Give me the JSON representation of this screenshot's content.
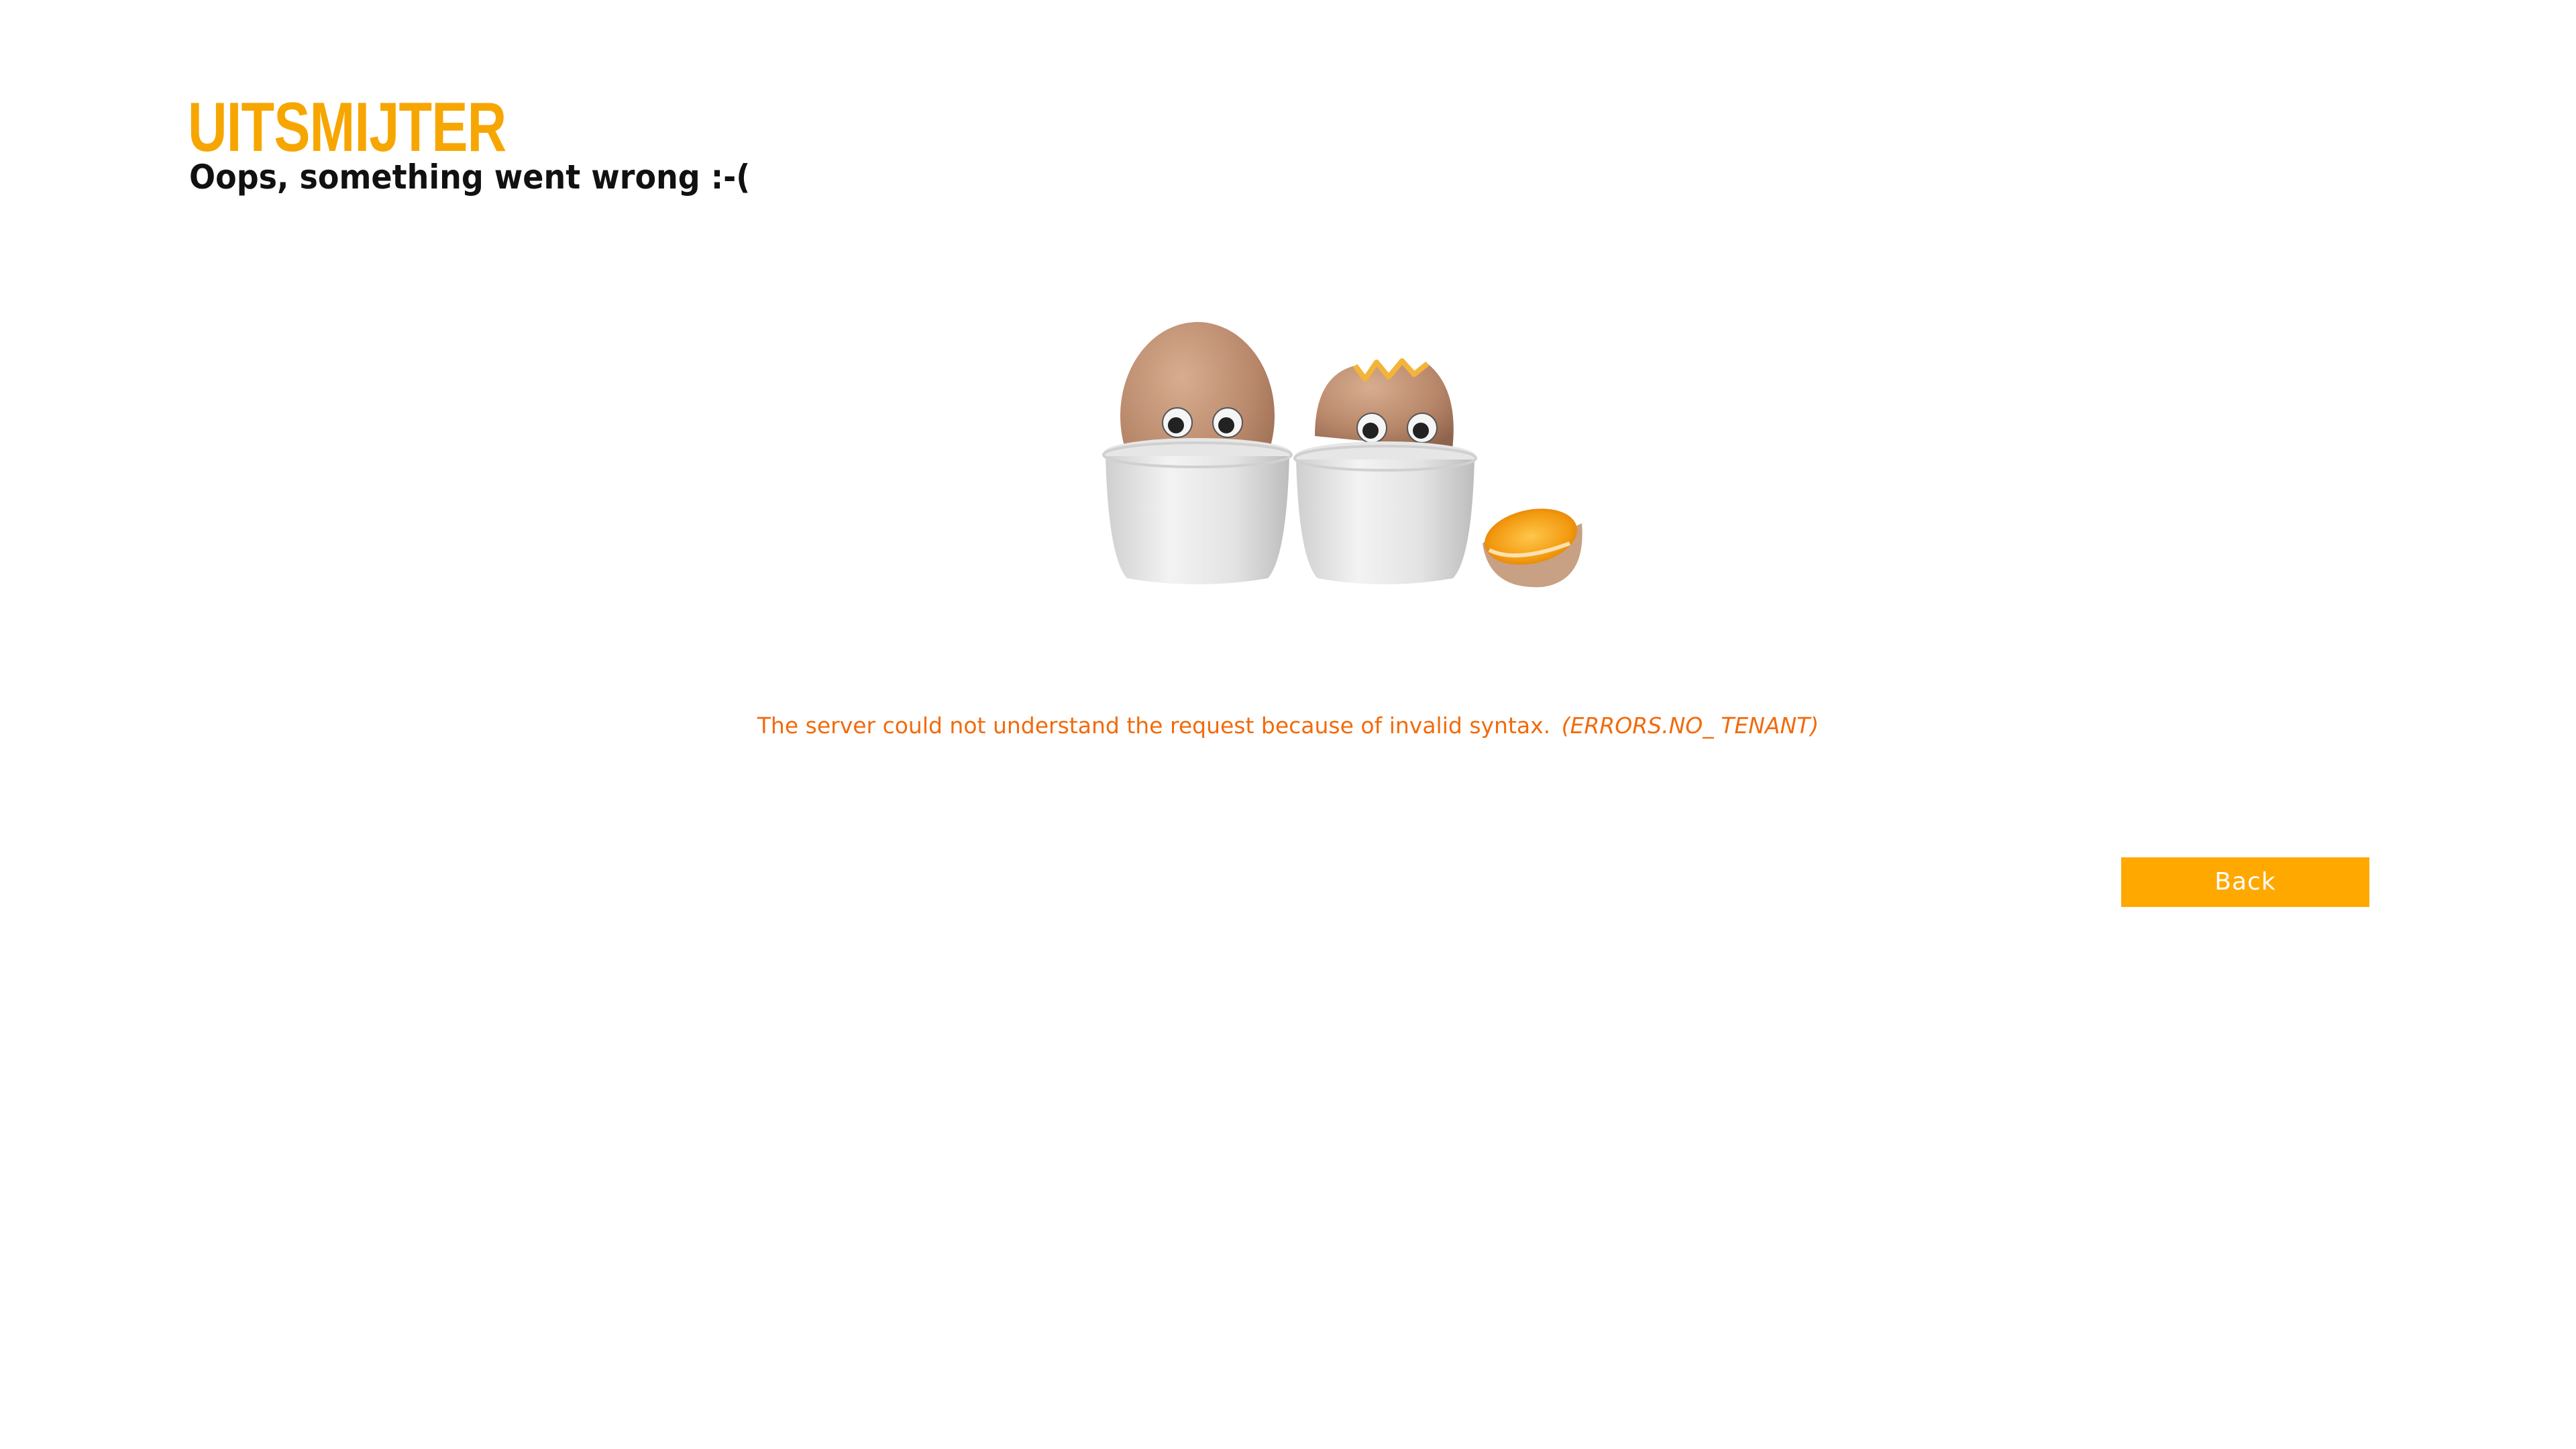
{
  "header": {
    "logo_text": "UITSMIJTER",
    "subtitle": "Oops, something went wrong :-("
  },
  "error": {
    "message": "The server could not understand the request because of invalid syntax.",
    "code": "(ERRORS.NO_ TENANT)"
  },
  "actions": {
    "back_label": "Back"
  },
  "illustration": {
    "name": "eggs-in-cups-icon"
  },
  "colors": {
    "brand": "#f7a600",
    "error_text": "#f26a0a",
    "button_bg": "#ffa800",
    "button_text": "#ffffff"
  }
}
